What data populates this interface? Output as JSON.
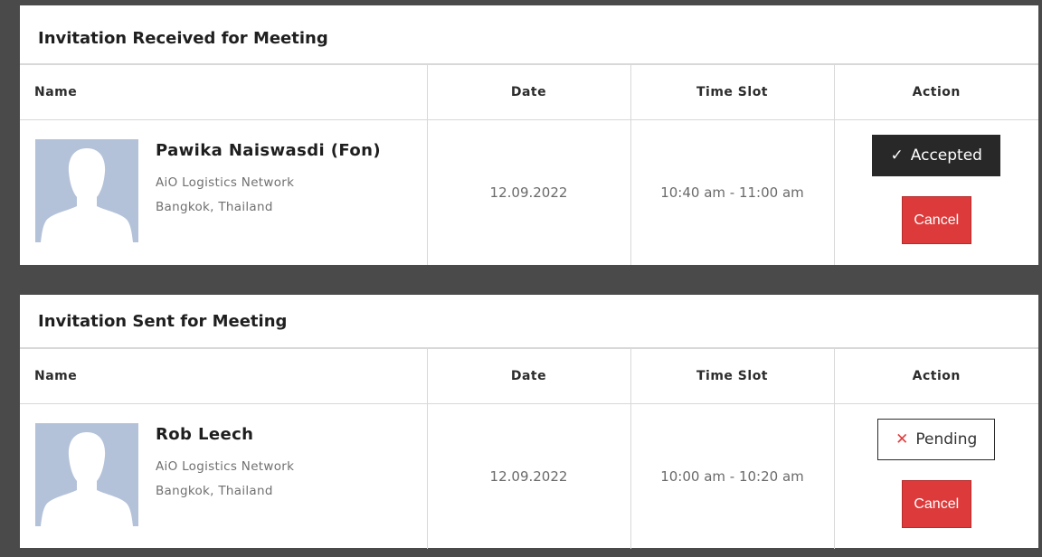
{
  "received": {
    "title": "Invitation Received for Meeting",
    "columns": [
      "Name",
      "Date",
      "Time Slot",
      "Action"
    ],
    "row": {
      "name": "Pawika Naiswasdi (Fon)",
      "company": "AiO Logistics Network",
      "location": "Bangkok, Thailand",
      "date": "12.09.2022",
      "time_slot": "10:40 am - 11:00 am",
      "status_label": "Accepted",
      "status_icon": "check-icon",
      "cancel_label": "Cancel"
    }
  },
  "sent": {
    "title": "Invitation Sent for Meeting",
    "columns": [
      "Name",
      "Date",
      "Time Slot",
      "Action"
    ],
    "row": {
      "name": "Rob Leech",
      "company": "AiO Logistics Network",
      "location": "Bangkok, Thailand",
      "date": "12.09.2022",
      "time_slot": "10:00 am - 10:20 am",
      "status_label": "Pending",
      "status_icon": "x-icon",
      "cancel_label": "Cancel"
    }
  },
  "colors": {
    "background": "#4a4a4a",
    "accepted_bg": "#282828",
    "cancel_bg": "#dd3b3b",
    "avatar_bg": "#b4c2d9"
  }
}
